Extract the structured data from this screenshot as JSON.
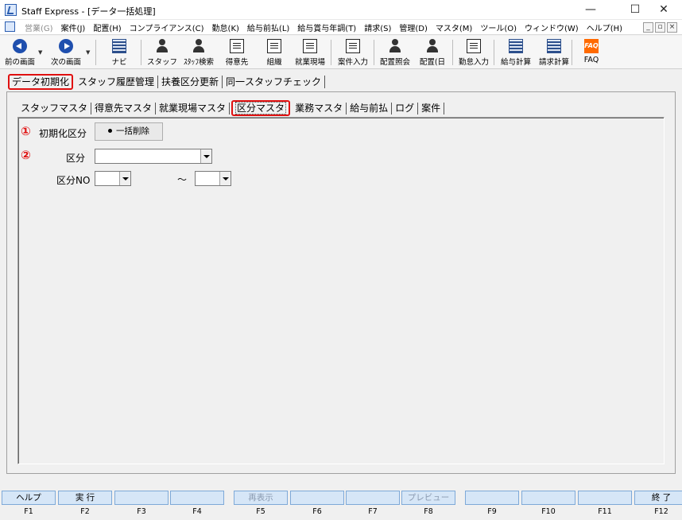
{
  "window": {
    "title": "Staff Express - [データ一括処理]",
    "minimize": "—",
    "maximize": "☐",
    "close": "✕"
  },
  "menu": [
    {
      "label": "営業(G)",
      "disabled": true
    },
    {
      "label": "案件(J)"
    },
    {
      "label": "配置(H)"
    },
    {
      "label": "コンプライアンス(C)"
    },
    {
      "label": "勤怠(K)"
    },
    {
      "label": "給与前払(L)"
    },
    {
      "label": "給与賞与年調(T)"
    },
    {
      "label": "請求(S)"
    },
    {
      "label": "管理(D)"
    },
    {
      "label": "マスタ(M)"
    },
    {
      "label": "ツール(O)"
    },
    {
      "label": "ウィンドウ(W)"
    },
    {
      "label": "ヘルプ(H)"
    }
  ],
  "mdi_controls": [
    "_",
    "▫",
    "×"
  ],
  "toolbar": [
    {
      "id": "back",
      "label": "前の画面",
      "icon": "back-arrow-icon"
    },
    {
      "id": "forward",
      "label": "次の画面",
      "icon": "forward-arrow-icon"
    },
    {
      "id": "navi",
      "label": "ナビ",
      "icon": "navi-icon"
    },
    {
      "id": "staff",
      "label": "スタッフ",
      "icon": "staff-icon"
    },
    {
      "id": "staff-search",
      "label": "ｽﾀｯﾌ検索",
      "icon": "staff-search-icon"
    },
    {
      "id": "client",
      "label": "得意先",
      "icon": "client-icon"
    },
    {
      "id": "org",
      "label": "組織",
      "icon": "organization-icon"
    },
    {
      "id": "worksite",
      "label": "就業現場",
      "icon": "worksite-icon"
    },
    {
      "id": "case-input",
      "label": "案件入力",
      "icon": "case-input-icon"
    },
    {
      "id": "assign-query",
      "label": "配置照会",
      "icon": "assignment-query-icon"
    },
    {
      "id": "assign-day",
      "label": "配置(日",
      "icon": "assignment-day-icon"
    },
    {
      "id": "attendance",
      "label": "勤怠入力",
      "icon": "attendance-icon"
    },
    {
      "id": "payroll",
      "label": "給与計算",
      "icon": "payroll-icon"
    },
    {
      "id": "billing",
      "label": "請求計算",
      "icon": "billing-icon"
    },
    {
      "id": "faq",
      "label": "FAQ",
      "icon": "faq-icon"
    }
  ],
  "toolbar_dropdown_glyph": "▼",
  "faq_icon_text": "FAQ",
  "main_tabs": [
    {
      "label": "データ初期化",
      "active": true
    },
    {
      "label": "スタッフ履歴管理"
    },
    {
      "label": "扶養区分更新"
    },
    {
      "label": "同一スタッフチェック"
    }
  ],
  "sub_tabs": [
    {
      "label": "スタッフマスタ"
    },
    {
      "label": "得意先マスタ"
    },
    {
      "label": "就業現場マスタ"
    },
    {
      "label": "区分マスタ",
      "active": true
    },
    {
      "label": "業務マスタ"
    },
    {
      "label": "給与前払"
    },
    {
      "label": "ログ"
    },
    {
      "label": "案件"
    }
  ],
  "form": {
    "mark1": "①",
    "mark2": "②",
    "init_label": "初期化区分",
    "bulk_delete_label": "一括削除",
    "category_label": "区分",
    "category_value": "",
    "category_no_label": "区分NO",
    "range_sep": "～",
    "no_from": "",
    "no_to": ""
  },
  "function_keys": [
    {
      "key": "F1",
      "label": "ヘルプ"
    },
    {
      "key": "F2",
      "label": "実 行"
    },
    {
      "key": "F3",
      "label": ""
    },
    {
      "key": "F4",
      "label": ""
    },
    {
      "key": "F5",
      "label": "再表示",
      "disabled": true
    },
    {
      "key": "F6",
      "label": ""
    },
    {
      "key": "F7",
      "label": ""
    },
    {
      "key": "F8",
      "label": "プレビュー",
      "disabled": true
    },
    {
      "key": "F9",
      "label": ""
    },
    {
      "key": "F10",
      "label": ""
    },
    {
      "key": "F11",
      "label": ""
    },
    {
      "key": "F12",
      "label": "終 了"
    }
  ],
  "colors": {
    "highlight": "#e01010",
    "fkey_bg": "#d6e6f7",
    "icon_blue": "#1f4fae"
  }
}
